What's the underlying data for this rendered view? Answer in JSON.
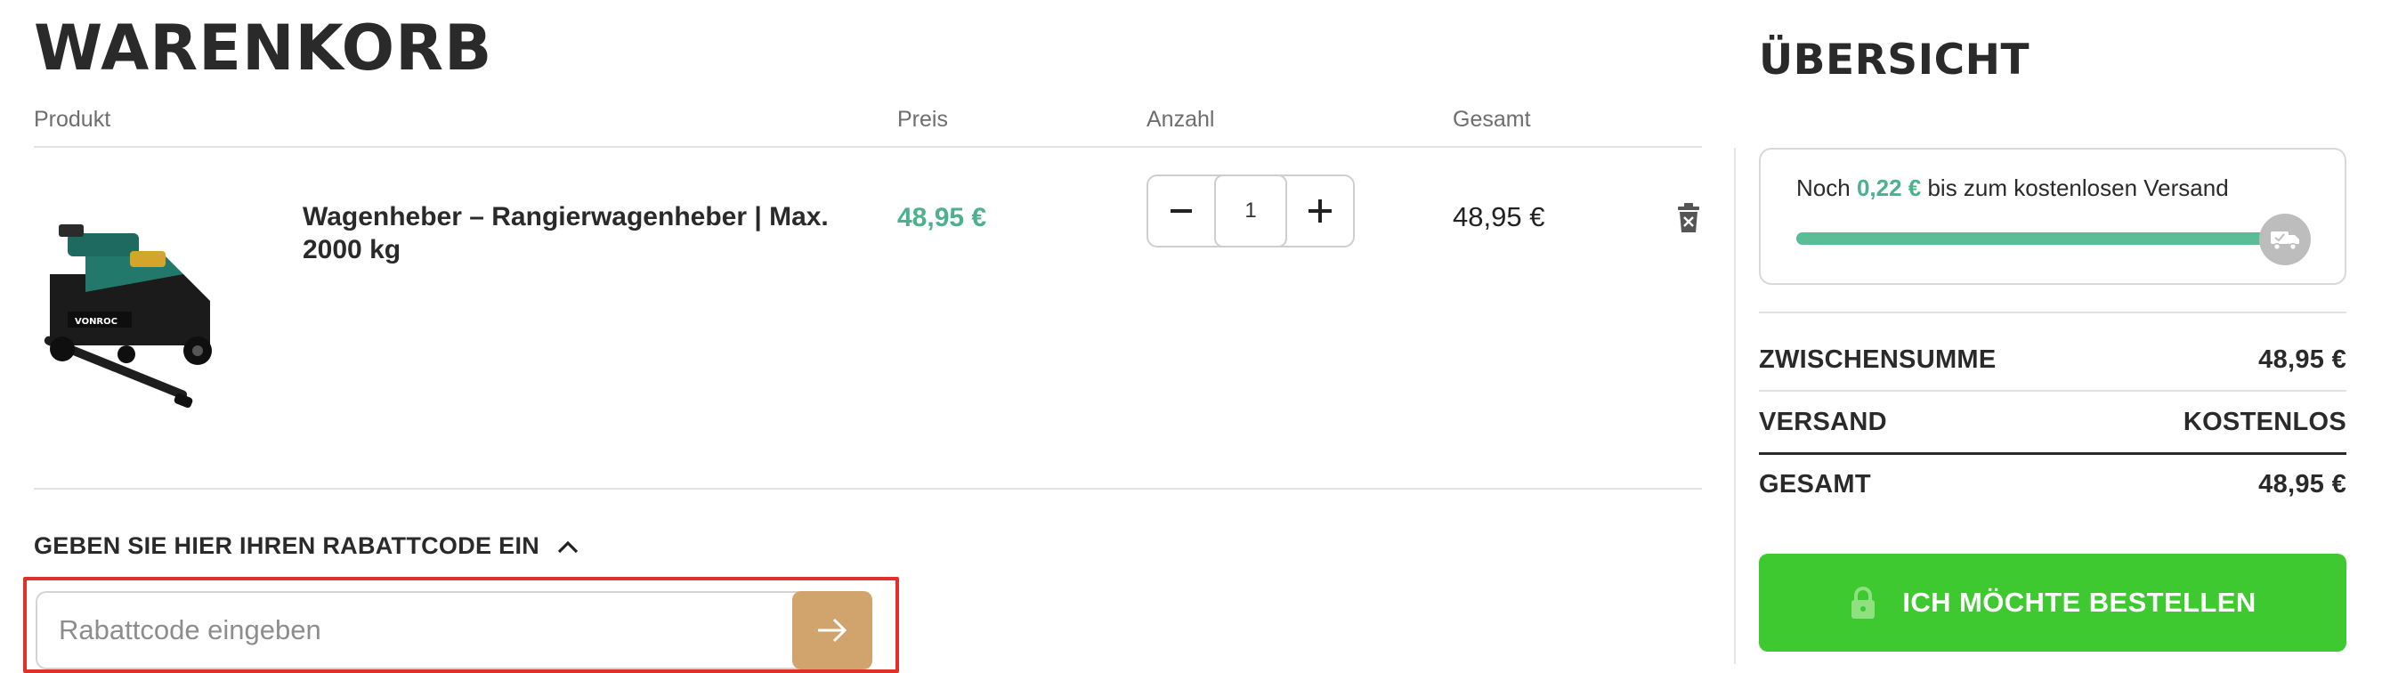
{
  "cart": {
    "title": "WARENKORB",
    "columns": {
      "product": "Produkt",
      "price": "Preis",
      "quantity": "Anzahl",
      "total": "Gesamt"
    },
    "items": [
      {
        "name": "Wagenheber – Rangierwagenheber | Max. 2000 kg",
        "price": "48,95 €",
        "quantity": "1",
        "total": "48,95 €",
        "image_icon": "floor-jack-image",
        "image_brand_text": "VONROC"
      }
    ]
  },
  "coupon": {
    "toggle_label": "GEBEN SIE HIER IHREN RABATTCODE EIN",
    "placeholder": "Rabattcode eingeben",
    "value": "",
    "submit_icon": "arrow-right-icon"
  },
  "summary": {
    "title": "ÜBERSICHT",
    "shipping_progress": {
      "prefix": "Noch",
      "amount": "0,22 €",
      "suffix": "bis zum kostenlosen Versand",
      "progress_fraction": 0.99,
      "icon": "truck-icon"
    },
    "subtotal": {
      "label": "ZWISCHENSUMME",
      "value": "48,95 €"
    },
    "shipping": {
      "label": "VERSAND",
      "value": "KOSTENLOS"
    },
    "total": {
      "label": "GESAMT",
      "value": "48,95 €"
    },
    "order_button": {
      "label": "ICH MÖCHTE BESTELLEN",
      "icon": "lock-icon"
    }
  },
  "colors": {
    "accent_green": "#4cb18c",
    "order_button": "#3ec930",
    "coupon_button": "#d2a46d",
    "focus_outline": "#e0302a"
  }
}
